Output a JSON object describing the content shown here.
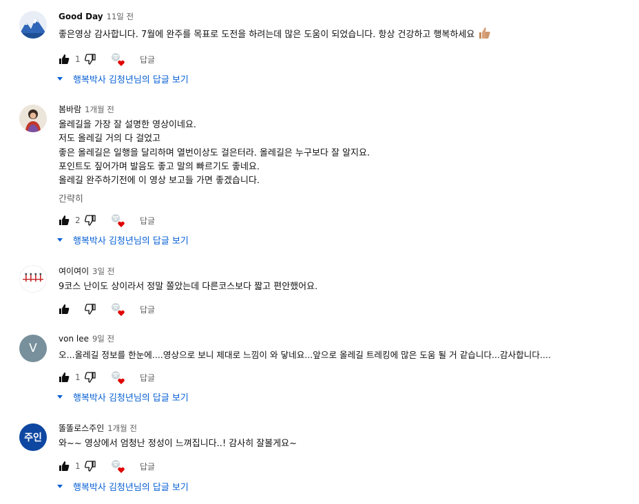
{
  "comments": [
    {
      "author": "Good Day",
      "time": "11일 전",
      "lines": [
        "좋은영상 감사합니다. 7월에 완주를 목표로 도전을 하려는데 많은 도움이 되었습니다. 항상 건강하고 행복하세요"
      ],
      "emoji": "thumbs-up-emoji",
      "likes": "1",
      "reply_label": "답글",
      "view_replies": "행복박사 김청년님의 답글 보기"
    },
    {
      "author": "봄바람",
      "time": "1개월 전",
      "lines": [
        "올레길을 가장 잘 설명한 영상이네요.",
        "저도 올레길 거의 다 걸었고",
        "좋은 올레길은 일행을 달리하며 열번이상도 걸은터라. 올레길은 누구보다 잘 알지요.",
        "포인트도 짚어가며 발음도 좋고 말의 빠르기도 좋네요.",
        "올레길 완주하기전에 이 영상 보고들 가면 좋겠습니다."
      ],
      "read_less": "간략히",
      "likes": "2",
      "reply_label": "답글",
      "view_replies": "행복박사 김청년님의 답글 보기"
    },
    {
      "author": "여이여이",
      "time": "3일 전",
      "lines": [
        "9코스 난이도 상이라서 정말 쫄았는데 다른코스보다 짧고 편안했어요."
      ],
      "likes": "",
      "reply_label": "답글"
    },
    {
      "author": "von lee",
      "time": "9일 전",
      "avatar_letter": "V",
      "lines": [
        "오...올레길 정보를 한눈에....영상으로 보니 제대로 느낌이 와 닿네요...앞으로 올레길 트레킹에 많은 도움 될 거 같습니다...감사합니다...."
      ],
      "likes": "1",
      "reply_label": "답글",
      "view_replies": "행복박사 김청년님의 답글 보기"
    },
    {
      "author": "똘똘로스주인",
      "time": "1개월 전",
      "avatar_letter": "주인",
      "lines": [
        "와~~ 영상에서 엄청난 정성이 느껴집니다..! 감사히 잘볼게요~"
      ],
      "likes": "1",
      "reply_label": "답글",
      "view_replies": "행복박사 김청년님의 답글 보기"
    }
  ],
  "colors": {
    "link_blue": "#065fd4",
    "meta_gray": "#606060",
    "heart_red": "#e00000",
    "avatar_v": "#78909c",
    "avatar_jooin": "#0d47a1"
  }
}
